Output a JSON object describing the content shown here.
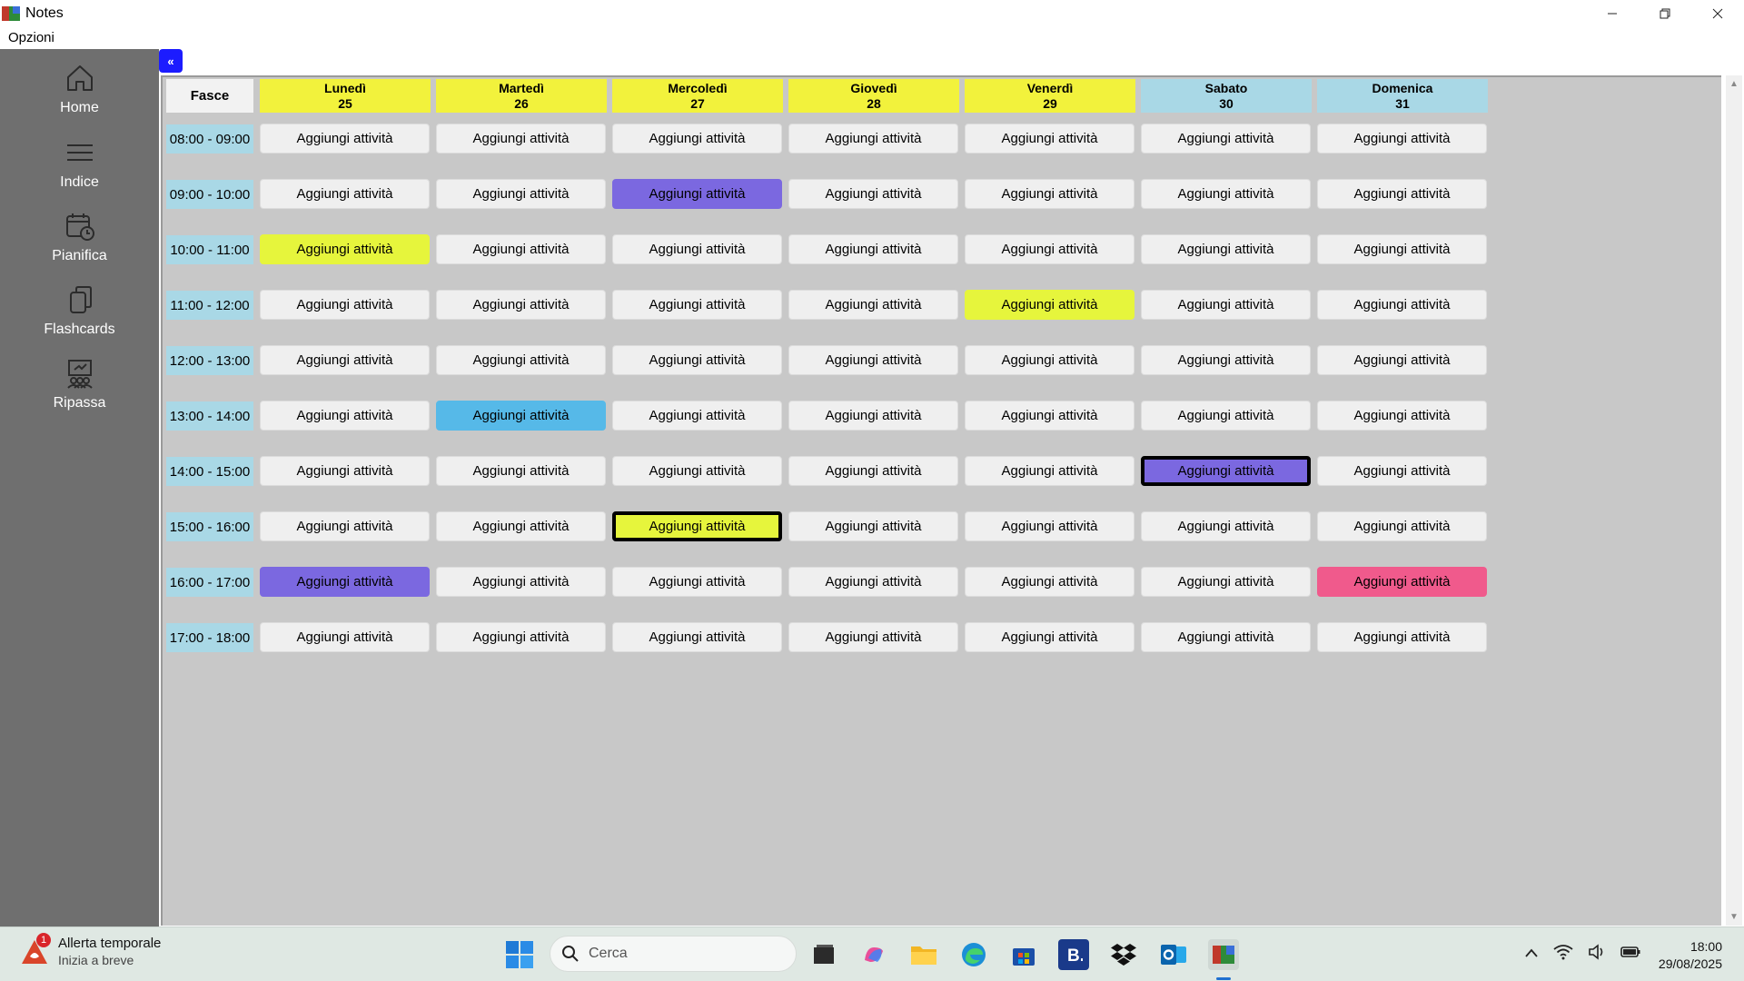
{
  "window": {
    "title": "Notes"
  },
  "menu": {
    "options_label": "Opzioni"
  },
  "sidebar": {
    "items": [
      {
        "label": "Home",
        "icon": "home-icon"
      },
      {
        "label": "Indice",
        "icon": "list-icon"
      },
      {
        "label": "Pianifica",
        "icon": "calendar-clock-icon"
      },
      {
        "label": "Flashcards",
        "icon": "cards-icon"
      },
      {
        "label": "Ripassa",
        "icon": "review-icon"
      }
    ]
  },
  "main": {
    "collapse_label": "«",
    "fasce_label": "Fasce",
    "days": [
      {
        "name": "Lunedì",
        "date": "25",
        "color": "#f2f23c"
      },
      {
        "name": "Martedì",
        "date": "26",
        "color": "#f2f23c"
      },
      {
        "name": "Mercoledì",
        "date": "27",
        "color": "#f2f23c"
      },
      {
        "name": "Giovedì",
        "date": "28",
        "color": "#f2f23c"
      },
      {
        "name": "Venerdì",
        "date": "29",
        "color": "#f2f23c"
      },
      {
        "name": "Sabato",
        "date": "30",
        "color": "#a9d8e6"
      },
      {
        "name": "Domenica",
        "date": "31",
        "color": "#a9d8e6"
      }
    ],
    "time_slots": [
      "08:00 - 09:00",
      "09:00 - 10:00",
      "10:00 - 11:00",
      "11:00 - 12:00",
      "12:00 - 13:00",
      "13:00 - 14:00",
      "14:00 - 15:00",
      "15:00 - 16:00",
      "16:00 - 17:00",
      "17:00 - 18:00"
    ],
    "cell_label": "Aggiungi attività",
    "colored_cells": [
      {
        "slot": 1,
        "day": 2,
        "color": "#7b68e0",
        "bold": false
      },
      {
        "slot": 2,
        "day": 0,
        "color": "#e6f53c",
        "bold": false
      },
      {
        "slot": 3,
        "day": 4,
        "color": "#e6f53c",
        "bold": false
      },
      {
        "slot": 5,
        "day": 1,
        "color": "#56b9e8",
        "bold": false
      },
      {
        "slot": 6,
        "day": 5,
        "color": "#7b68e0",
        "bold": true
      },
      {
        "slot": 7,
        "day": 2,
        "color": "#e6f53c",
        "bold": true
      },
      {
        "slot": 8,
        "day": 0,
        "color": "#7b68e0",
        "bold": false
      },
      {
        "slot": 8,
        "day": 6,
        "color": "#f05a8c",
        "bold": false
      }
    ]
  },
  "taskbar": {
    "weather_badge": "1",
    "weather_title": "Allerta temporale",
    "weather_subtitle": "Inizia a breve",
    "search_placeholder": "Cerca",
    "time": "18:00",
    "date": "29/08/2025"
  }
}
